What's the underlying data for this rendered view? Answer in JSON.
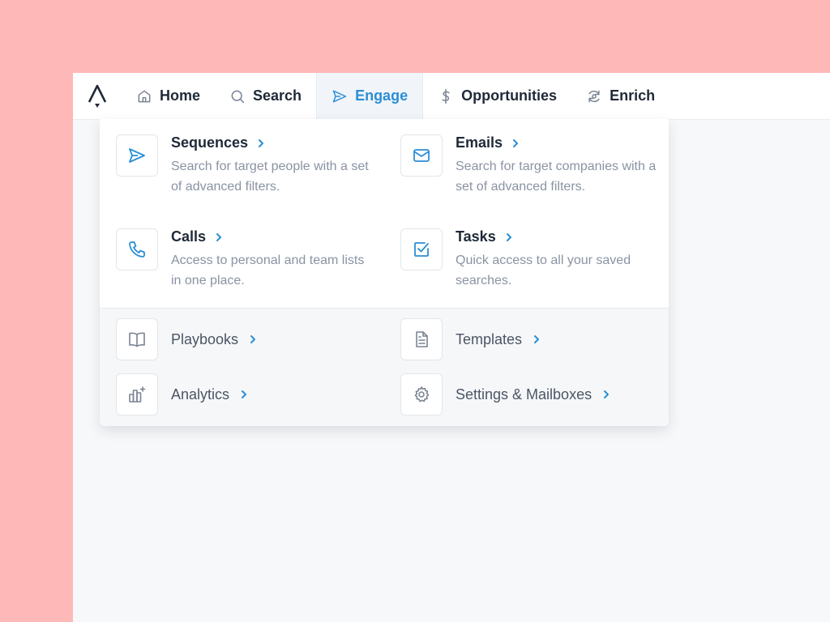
{
  "nav": {
    "items": [
      {
        "label": "Home",
        "icon": "home-icon"
      },
      {
        "label": "Search",
        "icon": "search-icon"
      },
      {
        "label": "Engage",
        "icon": "send-icon",
        "active": true
      },
      {
        "label": "Opportunities",
        "icon": "dollar-icon"
      },
      {
        "label": "Enrich",
        "icon": "refresh-icon"
      }
    ]
  },
  "dropdown": {
    "features": [
      {
        "title": "Sequences",
        "desc": "Search for target people with a set of advanced filters.",
        "icon": "send-icon"
      },
      {
        "title": "Emails",
        "desc": "Search for target companies with a set of advanced filters.",
        "icon": "mail-icon"
      },
      {
        "title": "Calls",
        "desc": "Access to personal and team lists in one place.",
        "icon": "phone-icon"
      },
      {
        "title": "Tasks",
        "desc": "Quick access to all your saved searches.",
        "icon": "checkbox-icon"
      }
    ],
    "links": [
      {
        "label": "Playbooks",
        "icon": "book-icon"
      },
      {
        "label": "Templates",
        "icon": "document-icon"
      },
      {
        "label": "Analytics",
        "icon": "chart-icon"
      },
      {
        "label": "Settings & Mailboxes",
        "icon": "gear-icon"
      }
    ]
  },
  "colors": {
    "accent": "#2a8fd6",
    "background": "#ffb8b8",
    "text_dark": "#1f2937",
    "text_muted": "#8a93a3"
  }
}
